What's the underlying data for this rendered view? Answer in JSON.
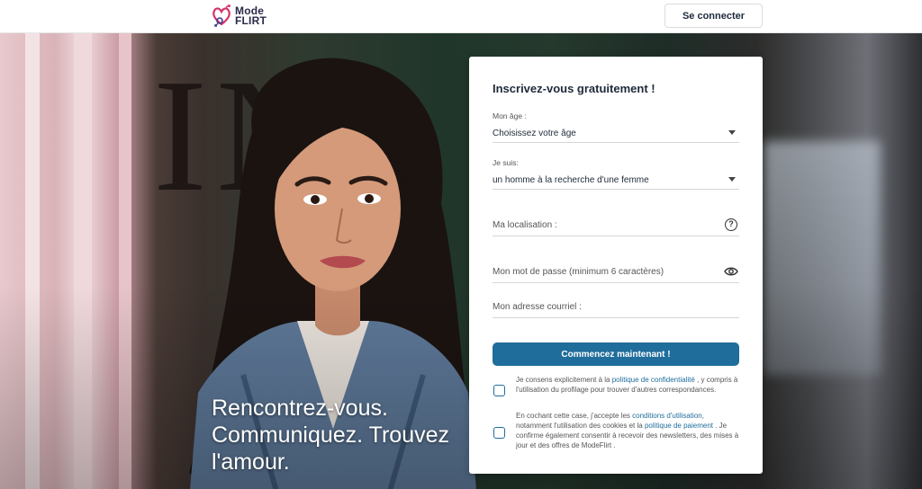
{
  "header": {
    "logo_line1": "Mode",
    "logo_line2": "FLIRT",
    "login_label": "Se connecter"
  },
  "hero": {
    "tagline": "Rencontrez-vous. Communiquez. Trouvez l'amour."
  },
  "form": {
    "title": "Inscrivez-vous gratuitement !",
    "age": {
      "label": "Mon âge :",
      "value": "Choisissez votre âge"
    },
    "gender": {
      "label": "Je suis:",
      "value": "un homme à la recherche d'une femme"
    },
    "location": {
      "placeholder": "Ma localisation :"
    },
    "password": {
      "placeholder": "Mon mot de passe (minimum 6 caractères)"
    },
    "email": {
      "placeholder": "Mon adresse courriel :"
    },
    "cta_label": "Commencez maintenant !",
    "consent1": {
      "pre": "Je consens explicitement à la ",
      "link": "politique de confidentialité",
      "post": " , y compris à l'utilisation du profilage pour trouver d'autres correspondances."
    },
    "consent2": {
      "pre": "En cochant cette case, j'accepte les ",
      "link1": "conditions d'utilisation",
      "mid": ", notamment l'utilisation des cookies et la ",
      "link2": "politique de paiement",
      "post": " . Je confirme également consentir à recevoir des newsletters, des mises à jour et des offres de ModeFlirt ."
    }
  },
  "colors": {
    "brand_blue": "#1f6d9b",
    "logo_pink": "#d6336c",
    "text_dark": "#1e2a3a"
  },
  "icons": [
    "heart-logo-icon",
    "caret-down-icon",
    "help-circle-icon",
    "eye-icon",
    "checkbox-icon"
  ]
}
